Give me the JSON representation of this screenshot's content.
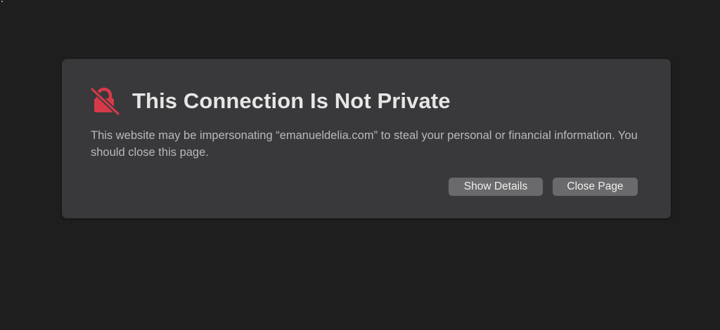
{
  "colors": {
    "background": "#1e1e1f",
    "card": "#39393b",
    "title_text": "#e6e6e6",
    "message_text": "#b9b9bb",
    "button": "#6a6a6c",
    "button_text": "#efefef",
    "icon_red": "#d63a4a"
  },
  "warning": {
    "icon": "lock-slash-icon",
    "title": "This Connection Is Not Private",
    "message": "This website may be impersonating “emanueldelia.com” to steal your personal or financial information. You should close this page."
  },
  "actions": {
    "show_details_label": "Show Details",
    "close_page_label": "Close Page"
  }
}
